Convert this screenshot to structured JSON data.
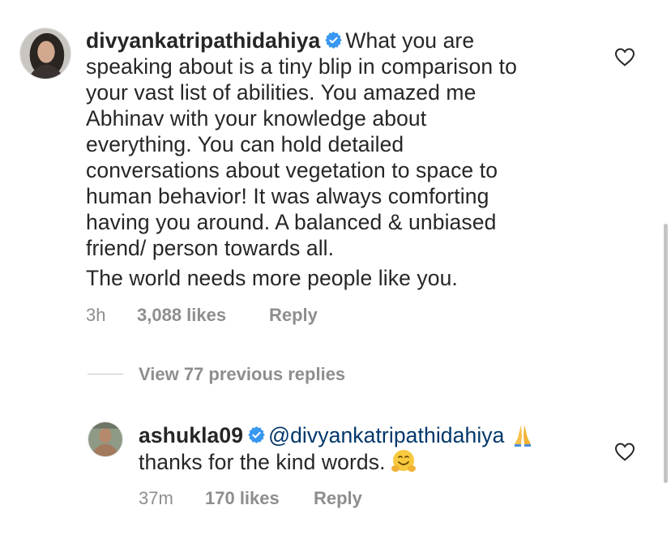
{
  "comment": {
    "username": "divyankatripathidahiya",
    "text_lines": [
      "What you are",
      "speaking about is a tiny blip in comparison to",
      "your vast list of abilities. You amazed me",
      "Abhinav with your knowledge about",
      "everything. You can hold detailed",
      "conversations about vegetation to space to",
      "human behavior! It was always comforting",
      "having you around. A balanced & unbiased",
      "friend/ person towards all.",
      "The world needs more people like you."
    ],
    "time": "3h",
    "likes": "3,088 likes",
    "reply_label": "Reply"
  },
  "view_replies_label": "View 77 previous replies",
  "reply": {
    "username": "ashukla09",
    "mention": "@divyankatripathidahiya",
    "text": "thanks for the kind words.",
    "time": "37m",
    "likes": "170 likes",
    "reply_label": "Reply"
  },
  "icons": {
    "verified": "verified-badge-icon",
    "like": "heart-outline-icon",
    "emoji_1": "folded-hands-emoji",
    "emoji_2": "hugging-face-emoji"
  },
  "colors": {
    "text": "#262626",
    "secondary": "#8e8e8e",
    "verified": "#3897f0",
    "mention": "#00376b"
  }
}
